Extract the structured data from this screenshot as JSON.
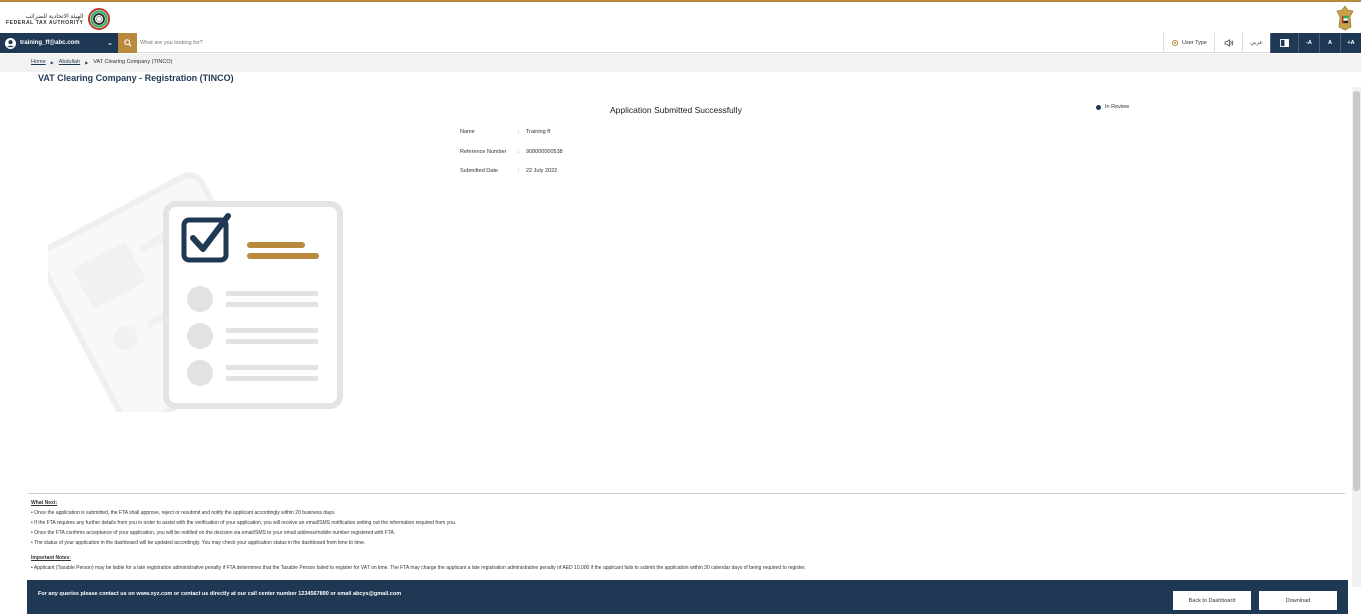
{
  "header": {
    "logo_ar": "الهيئة الاتحادية للضرائب",
    "logo_en": "FEDERAL TAX AUTHORITY"
  },
  "toolbar": {
    "user_email": "training_ff@abc.com",
    "search_placeholder": "What are you looking for?",
    "user_type_label": "User Type",
    "language_label": "عربي",
    "font_decrease": "-A",
    "font_normal": "A",
    "font_increase": "+A"
  },
  "breadcrumb": {
    "home": "Home",
    "user": "Abdullah",
    "current": "VAT Clearing Company (TINCO)"
  },
  "page": {
    "title": "VAT Clearing Company - Registration (TINCO)",
    "success_title": "Application Submitted Successfully",
    "status": "In Review"
  },
  "details": [
    {
      "label": "Name",
      "value": "Training ff"
    },
    {
      "label": "Reference Number",
      "value": "908000000538"
    },
    {
      "label": "Submitted Date",
      "value": "22 July 2022"
    }
  ],
  "notes": {
    "what_next_heading": "What Next:",
    "what_next": [
      "• Once the application is submitted, the FTA shall approve, reject or resubmit and notify the applicant accordingly within 20 business days.",
      "• If the FTA requires any further details from you in order to assist with the verification of your application, you will receive an email/SMS notification setting out the information required from you.",
      "• Once the FTA confirms acceptance of your application, you will be notified on the decision via email/SMS to your email address/mobile number registered with FTA.",
      "• The status of your application in the dashboard will be updated accordingly. You may check your application status in the dashboard from time to time."
    ],
    "important_heading": "Important Notes:",
    "important": [
      "• Applicant (Taxable Person) may be liable for a late registration administrative penalty if FTA determines that the Taxable Person failed to register for VAT on time. The FTA may charge the applicant a late registration administrative penalty of AED 10,000 if the applicant fails to submit the application within 30 calendar days of being required to register."
    ]
  },
  "footer": {
    "contact_text": "For any queries please contact us on www.xyz.com or contact us directly at our call center number 1234567890 or email abcys@gmail.com",
    "back_label": "Back to Dashboard",
    "download_label": "Download"
  },
  "colors": {
    "navy": "#1f3954",
    "gold": "#b98a3e"
  }
}
